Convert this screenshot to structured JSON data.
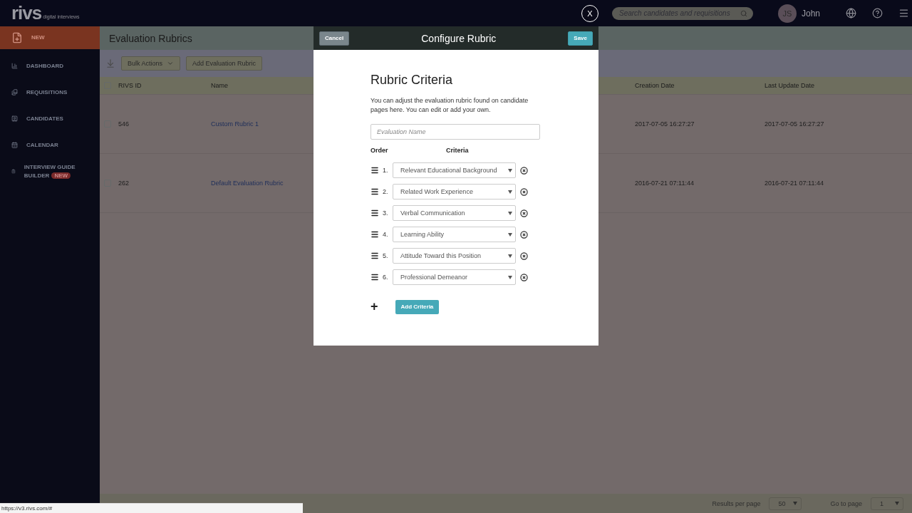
{
  "header": {
    "logo": "rivs",
    "logo_tagline": "digital interviews",
    "search": {
      "placeholder": "Search candidates and requisitions"
    },
    "user": {
      "initials": "JS",
      "name": "John"
    }
  },
  "sidebar": {
    "items": [
      {
        "label": "NEW",
        "selected": true
      },
      {
        "label": "DASHBOARD",
        "selected": false
      },
      {
        "label": "REQUISITIONS",
        "selected": false
      },
      {
        "label": "CANDIDATES",
        "selected": false
      },
      {
        "label": "CALENDAR",
        "selected": false
      },
      {
        "label": "INTERVIEW GUIDE BUILDER",
        "selected": false,
        "badge": "NEW"
      }
    ]
  },
  "page": {
    "title": "Evaluation Rubrics",
    "toolbar": {
      "bulk_actions": "Bulk Actions",
      "add_button": "Add Evaluation Rubric"
    },
    "table": {
      "select_all_checked": false,
      "columns": [
        "RIVS ID",
        "Name",
        "Creation Date",
        "Last Update Date"
      ],
      "rows": [
        {
          "id": "546",
          "name": "Custom Rubric 1",
          "created": "2017-07-05 16:27:27",
          "updated": "2017-07-05 16:27:27",
          "checked": false
        },
        {
          "id": "262",
          "name": "Default Evaluation Rubric",
          "created": "2016-07-21 07:11:44",
          "updated": "2016-07-21 07:11:44",
          "checked": false
        }
      ]
    },
    "footer": {
      "results_label": "Results per page",
      "results_value": "50",
      "page_label": "Go to page",
      "page_value": "1"
    }
  },
  "modal": {
    "title": "Configure Rubric",
    "cancel": "Cancel",
    "save": "Save",
    "heading": "Rubric Criteria",
    "description": "You can adjust the evaluation rubric found on candidate pages here. You can edit or add your own.",
    "name_field": {
      "placeholder": "Evaluation Name"
    },
    "order_label": "Order",
    "criteria_label": "Criteria",
    "criteria": [
      {
        "number": "1.",
        "value": "Relevant Educational Background"
      },
      {
        "number": "2.",
        "value": "Related Work Experience"
      },
      {
        "number": "3.",
        "value": "Verbal Communication"
      },
      {
        "number": "4.",
        "value": "Learning Ability"
      },
      {
        "number": "5.",
        "value": "Attitude Toward this Position"
      },
      {
        "number": "6.",
        "value": "Professional Demeanor"
      }
    ],
    "add_icon": "+",
    "add_button": "Add Criteria"
  },
  "close_overlay": "X",
  "status_bar": {
    "url": "https://v3.rivs.com/#"
  }
}
